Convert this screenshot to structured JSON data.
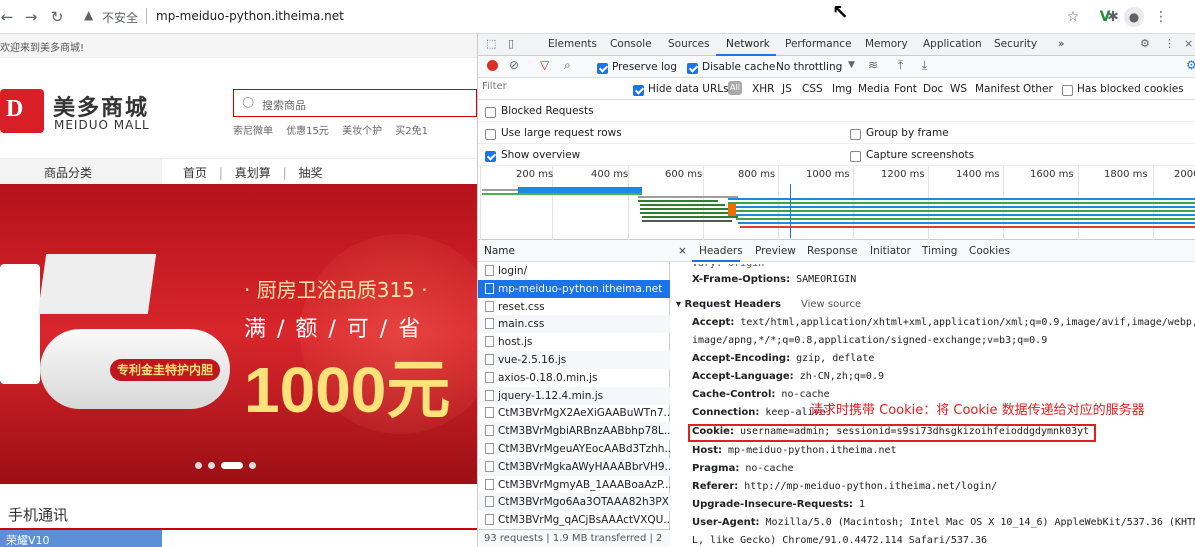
{
  "browser": {
    "url": "mp-meiduo-python.itheima.net",
    "security_label": "不安全",
    "warn_glyph": "▲",
    "icons": [
      "back-icon",
      "forward-icon",
      "reload-icon",
      "star-icon",
      "extension-icon",
      "puzzle-icon",
      "profile-icon",
      "menu-icon"
    ]
  },
  "site": {
    "welcome": "欢迎来到美多商城!",
    "logo_cn": "美多商城",
    "logo_en": "MEIDUO MALL",
    "logo_mark": "D",
    "search_placeholder": "搜索商品",
    "hot_words": [
      "索尼微单",
      "优惠15元",
      "美妆个护",
      "买2免1"
    ],
    "category_label": "商品分类",
    "nav": [
      "首页",
      "真划算",
      "抽奖"
    ],
    "nav_sep": "|",
    "banner": {
      "line1": "· 厨房卫浴品质315 ·",
      "line2": "满 / 额 / 可 / 省",
      "line3": "1000元",
      "badge": "专利金圭特护内胆"
    },
    "section_title": "手机通讯",
    "section_tab": "荣耀V10"
  },
  "devtools": {
    "tabs": [
      "Elements",
      "Console",
      "Sources",
      "Network",
      "Performance",
      "Memory",
      "Application",
      "Security",
      "»"
    ],
    "active_tab": "Network",
    "toolbar": {
      "preserve_log": "Preserve log",
      "disable_cache": "Disable cache",
      "throttling": "No throttling"
    },
    "filter": {
      "placeholder": "Filter",
      "hide_data_urls": "Hide data URLs",
      "all": "All",
      "types": [
        "XHR",
        "JS",
        "CSS",
        "Img",
        "Media",
        "Font",
        "Doc",
        "WS",
        "Manifest",
        "Other"
      ],
      "blocked_cookies": "Has blocked cookies",
      "blocked_requests": "Blocked Requests"
    },
    "options": {
      "large_rows": "Use large request rows",
      "group_by_frame": "Group by frame",
      "show_overview": "Show overview",
      "capture_screenshots": "Capture screenshots"
    },
    "timeline_ticks": [
      "200 ms",
      "400 ms",
      "600 ms",
      "800 ms",
      "1000 ms",
      "1200 ms",
      "1400 ms",
      "1600 ms",
      "1800 ms",
      "2000"
    ],
    "name_header": "Name",
    "requests": [
      {
        "name": "login/",
        "selected": false
      },
      {
        "name": "mp-meiduo-python.itheima.net",
        "selected": true
      },
      {
        "name": "reset.css",
        "selected": false
      },
      {
        "name": "main.css",
        "selected": false
      },
      {
        "name": "host.js",
        "selected": false
      },
      {
        "name": "vue-2.5.16.js",
        "selected": false
      },
      {
        "name": "axios-0.18.0.min.js",
        "selected": false
      },
      {
        "name": "jquery-1.12.4.min.js",
        "selected": false
      },
      {
        "name": "CtM3BVrMgX2AeXiGAABuWTn7...",
        "selected": false
      },
      {
        "name": "CtM3BVrMgbiARBnzAABbhp78L...",
        "selected": false
      },
      {
        "name": "CtM3BVrMgeuAYEocAABd3Tzhh...",
        "selected": false
      },
      {
        "name": "CtM3BVrMgkaAWyHAAABbrVH9...",
        "selected": false
      },
      {
        "name": "CtM3BVrMgmyAB_1AAABoaAzP...",
        "selected": false
      },
      {
        "name": "CtM3BVrMgo6Aa3OTAAA82h3PX...",
        "selected": false
      },
      {
        "name": "CtM3BVrMg_qACjBsAAActVXQU...",
        "selected": false
      }
    ],
    "footer": "93 requests  |  1.9 MB transferred  |  2",
    "detail_tabs": [
      "×",
      "Headers",
      "Preview",
      "Response",
      "Initiator",
      "Timing",
      "Cookies"
    ],
    "detail": {
      "vary": "Vary: origin",
      "x_frame": {
        "k": "X-Frame-Options:",
        "v": " SAMEORIGIN"
      },
      "request_headers": "▾ Request Headers",
      "view_source": "View source",
      "accept": {
        "k": "Accept:",
        "v": " text/html,application/xhtml+xml,application/xml;q=0.9,image/avif,image/webp,"
      },
      "accept2": "image/apng,*/*;q=0.8,application/signed-exchange;v=b3;q=0.9",
      "encoding": {
        "k": "Accept-Encoding:",
        "v": " gzip, deflate"
      },
      "language": {
        "k": "Accept-Language:",
        "v": " zh-CN,zh;q=0.9"
      },
      "cache": {
        "k": "Cache-Control:",
        "v": " no-cache"
      },
      "connection": {
        "k": "Connection:",
        "v": " keep-alive"
      },
      "cookie": {
        "k": "Cookie:",
        "v": " username=admin; sessionid=s9si73dhsgkizoihfeioddgdymnk03yt"
      },
      "host": {
        "k": "Host:",
        "v": " mp-meiduo-python.itheima.net"
      },
      "pragma": {
        "k": "Pragma:",
        "v": " no-cache"
      },
      "referer": {
        "k": "Referer:",
        "v": " http://mp-meiduo-python.itheima.net/login/"
      },
      "upgrade": {
        "k": "Upgrade-Insecure-Requests:",
        "v": " 1"
      },
      "ua": {
        "k": "User-Agent:",
        "v": " Mozilla/5.0 (Macintosh; Intel Mac OS X 10_14_6) AppleWebKit/537.36 (KHTM"
      },
      "ua2": "L, like Gecko) Chrome/91.0.4472.114 Safari/537.36"
    },
    "annotation": "请求时携带 Cookie：将 Cookie 数据传递给对应的服务器"
  },
  "colors": {
    "accent": "#1a73e8",
    "brand": "#d81e26",
    "annotation": "#e02020"
  }
}
